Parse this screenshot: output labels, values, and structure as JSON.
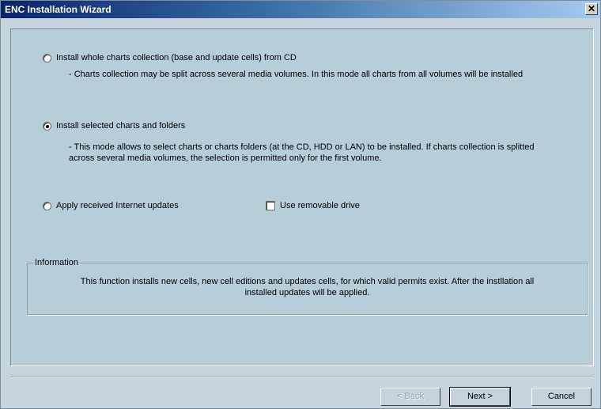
{
  "window": {
    "title": "ENC Installation Wizard",
    "close_glyph": "✕",
    "title_gradient": [
      "#0a246a",
      "#a6caf0"
    ],
    "background": "#b7cdd8"
  },
  "options": {
    "whole_collection": {
      "label": "Install whole charts collection (base and update cells) from CD",
      "description": "- Charts collection may be split across several media volumes. In this mode all charts from all volumes will be installed",
      "selected": false
    },
    "selected_charts": {
      "label": "Install selected charts and folders",
      "description": "- This mode allows to select charts or charts folders (at the CD, HDD or LAN) to be installed. If charts collection is splitted across several media volumes, the selection is permitted only for the first volume.",
      "selected": true
    },
    "internet_updates": {
      "label": "Apply received Internet updates",
      "selected": false
    }
  },
  "removable_drive": {
    "label": "Use removable drive",
    "checked": false
  },
  "information": {
    "legend": "Information",
    "text": "This function installs new cells, new cell editions and updates cells, for which valid permits exist. After the instllation all installed updates will be applied."
  },
  "buttons": {
    "back": "< Back",
    "next": "Next >",
    "cancel": "Cancel"
  }
}
